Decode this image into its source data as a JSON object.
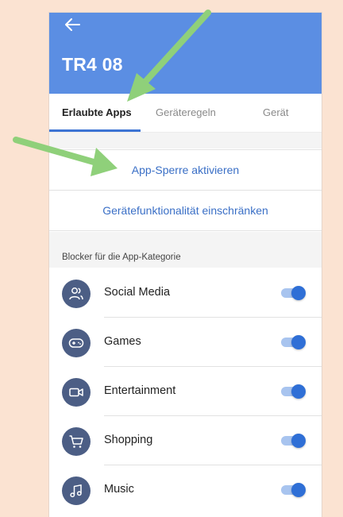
{
  "header": {
    "title": "TR4 08",
    "back_icon": "back-arrow-icon",
    "color": "#5b8ee3"
  },
  "tabs": [
    {
      "label": "Erlaubte Apps",
      "active": true
    },
    {
      "label": "Geräteregeln",
      "active": false
    },
    {
      "label": "Gerät",
      "active": false
    }
  ],
  "actions": {
    "app_lock": "App-Sperre aktivieren",
    "restrict": "Gerätefunktionalität einschränken"
  },
  "section": {
    "label": "Blocker für die App-Kategorie"
  },
  "categories": [
    {
      "label": "Social Media",
      "icon": "people-icon",
      "enabled": true
    },
    {
      "label": "Games",
      "icon": "gamepad-icon",
      "enabled": true
    },
    {
      "label": "Entertainment",
      "icon": "video-camera-icon",
      "enabled": true
    },
    {
      "label": "Shopping",
      "icon": "shopping-cart-icon",
      "enabled": true
    },
    {
      "label": "Music",
      "icon": "music-note-icon",
      "enabled": true
    }
  ],
  "colors": {
    "accent": "#3d74d4",
    "link": "#3a6fc6",
    "icon_bg": "#4c5e85",
    "arrow": "#8fd07a"
  }
}
